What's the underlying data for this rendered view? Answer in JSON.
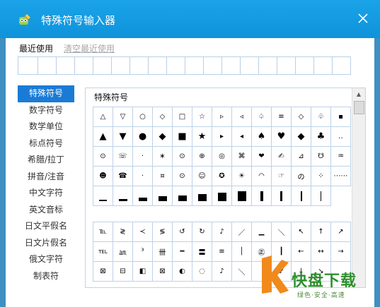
{
  "window": {
    "title": "特殊符号输入器",
    "title_bar_color": "#1096dd",
    "accent": "#1a7bd6"
  },
  "recent": {
    "label": "最近使用",
    "clear_label": "清空最近使用",
    "cell_count": 18
  },
  "categories": [
    {
      "label": "特殊符号",
      "active": true
    },
    {
      "label": "数字符号",
      "active": false
    },
    {
      "label": "数学单位",
      "active": false
    },
    {
      "label": "标点符号",
      "active": false
    },
    {
      "label": "希腊/拉丁",
      "active": false
    },
    {
      "label": "拼音/注音",
      "active": false
    },
    {
      "label": "中文字符",
      "active": false
    },
    {
      "label": "英文音标",
      "active": false
    },
    {
      "label": "日文平假名",
      "active": false
    },
    {
      "label": "日文片假名",
      "active": false
    },
    {
      "label": "俄文字符",
      "active": false
    },
    {
      "label": "制表符",
      "active": false
    }
  ],
  "panel": {
    "title": "特殊符号",
    "group1": [
      [
        "△",
        "▽",
        "○",
        "◇",
        "□",
        "☆",
        "▹",
        "◃",
        "♤",
        "≡",
        "◇",
        "♧",
        "▪"
      ],
      [
        "▲",
        "▼",
        "●",
        "◆",
        "■",
        "★",
        "▸",
        "◂",
        "♠",
        "♥",
        "◆",
        "♣",
        "‥"
      ],
      [
        "⊙",
        "☏",
        "·",
        "∗",
        "⊙",
        "⊕",
        "◎",
        "⌘",
        "❤",
        "✍",
        "⊿",
        "☋",
        "♒"
      ],
      [
        "☻",
        "☎",
        "·",
        "¤",
        "⊙",
        "☺",
        "✪",
        "☀",
        "◠",
        "☞",
        "の",
        "⁘",
        "⋯⋯"
      ],
      [
        "▁",
        "▂",
        "▃",
        "▄",
        "▅",
        "▆",
        "▇",
        "█",
        "▌",
        "▍",
        "▎",
        "▏"
      ]
    ],
    "group2": [
      [
        "℡",
        "≷",
        "≺",
        "≶",
        "↺",
        "↻",
        "♪",
        "／",
        "▁",
        "＼",
        "↖",
        "↑",
        "↗"
      ],
      [
        "TEL",
        "㏂",
        "³",
        "卌",
        "━",
        "〓",
        "≡",
        "│",
        "㊣",
        "┃",
        "←",
        "↔",
        "→"
      ],
      [
        "⊠",
        "⊟",
        "◧",
        "⊠",
        "◐",
        "◌",
        "♪",
        "＼",
        "",
        "↙",
        "↓",
        "↘",
        ""
      ]
    ]
  },
  "watermark": {
    "brand": "快盘下载",
    "brand_big": "快 盘下载",
    "tagline": "绿色·安全·高速",
    "colors": {
      "orange": "#f08a1c",
      "green": "#2e8f2e"
    }
  }
}
